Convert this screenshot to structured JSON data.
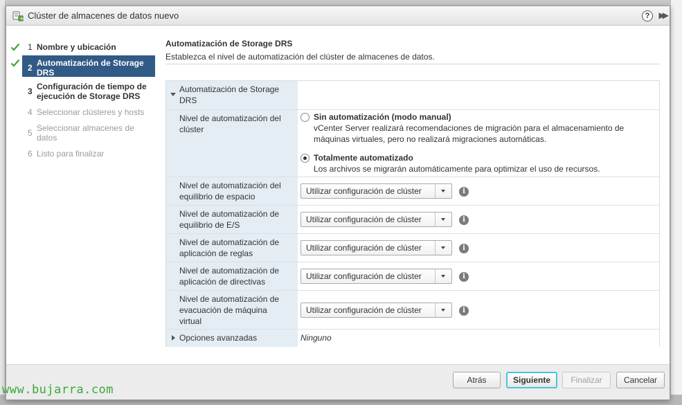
{
  "dialog": {
    "title": "Clúster de almacenes de datos nuevo",
    "help_label": "?",
    "expand_label": "▶▶"
  },
  "steps": [
    {
      "num": "1",
      "label": "Nombre y ubicación",
      "state": "done"
    },
    {
      "num": "2",
      "label": "Automatización de Storage DRS",
      "state": "active"
    },
    {
      "num": "3",
      "label": "Configuración de tiempo de ejecución de Storage DRS",
      "state": "todo"
    },
    {
      "num": "4",
      "label": "Seleccionar clústeres y hosts",
      "state": "disabled"
    },
    {
      "num": "5",
      "label": "Seleccionar almacenes de datos",
      "state": "disabled"
    },
    {
      "num": "6",
      "label": "Listo para finalizar",
      "state": "disabled"
    }
  ],
  "content": {
    "title": "Automatización de Storage DRS",
    "subtitle": "Establezca el nivel de automatización del clúster de almacenes de datos.",
    "section_label": "Automatización de Storage DRS",
    "cluster_level": {
      "label": "Nivel de automatización del clúster",
      "options": [
        {
          "title": "Sin automatización (modo manual)",
          "desc": "vCenter Server realizará recomendaciones de migración para el almacenamiento de máquinas virtuales, pero no realizará migraciones automáticas.",
          "checked": false
        },
        {
          "title": "Totalmente automatizado",
          "desc": "Los archivos se migrarán automáticamente para optimizar el uso de recursos.",
          "checked": true
        }
      ]
    },
    "settings": [
      {
        "label": "Nivel de automatización del equilibrio de espacio",
        "value": "Utilizar configuración de clúster"
      },
      {
        "label": "Nivel de automatización de equilibrio de E/S",
        "value": "Utilizar configuración de clúster"
      },
      {
        "label": "Nivel de automatización de aplicación de reglas",
        "value": "Utilizar configuración de clúster"
      },
      {
        "label": "Nivel de automatización de aplicación de directivas",
        "value": "Utilizar configuración de clúster"
      },
      {
        "label": "Nivel de automatización de evacuación de máquina virtual",
        "value": "Utilizar configuración de clúster"
      }
    ],
    "advanced": {
      "label": "Opciones avanzadas",
      "value": "Ninguno"
    }
  },
  "footer": {
    "back": "Atrás",
    "next": "Siguiente",
    "finish": "Finalizar",
    "cancel": "Cancelar"
  },
  "watermark": "www.bujarra.com",
  "colors": {
    "active_step": "#315a86",
    "label_column": "#e4edf4",
    "primary_focus": "#47c5e1",
    "check": "#3aa83a"
  }
}
